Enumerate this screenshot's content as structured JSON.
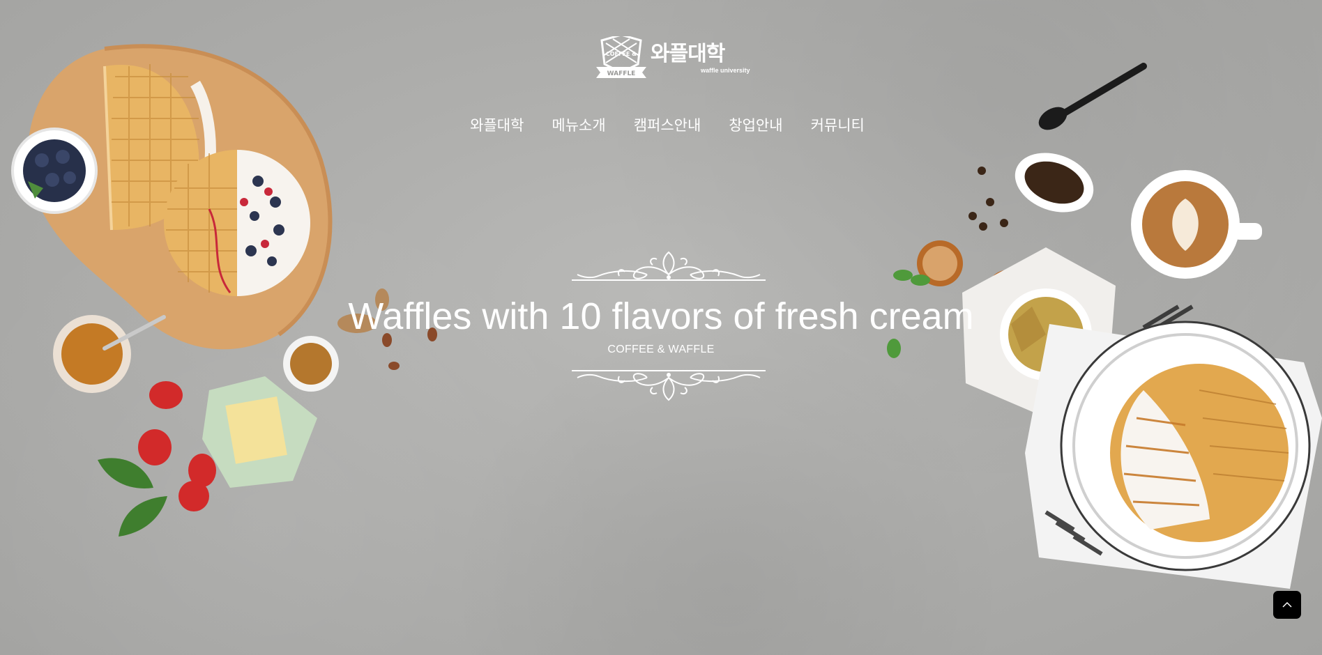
{
  "logo": {
    "korean": "와플대학",
    "english": "waffle university",
    "badge_line1": "COFFEE &",
    "badge_line2": "WAFFLE",
    "icon": "waffle-badge-icon"
  },
  "nav": {
    "items": [
      {
        "label": "와플대학"
      },
      {
        "label": "메뉴소개"
      },
      {
        "label": "캠퍼스안내"
      },
      {
        "label": "창업안내"
      },
      {
        "label": "커뮤니티"
      }
    ]
  },
  "hero": {
    "headline": "Waffles with 10 flavors of fresh cream",
    "subline": "COFFEE & WAFFLE",
    "ornament_icon": "flourish-ornament-icon"
  },
  "controls": {
    "scroll_top_icon": "chevron-up-icon"
  },
  "colors": {
    "background": "#aeaeac",
    "text": "#ffffff",
    "button": "#000000"
  }
}
